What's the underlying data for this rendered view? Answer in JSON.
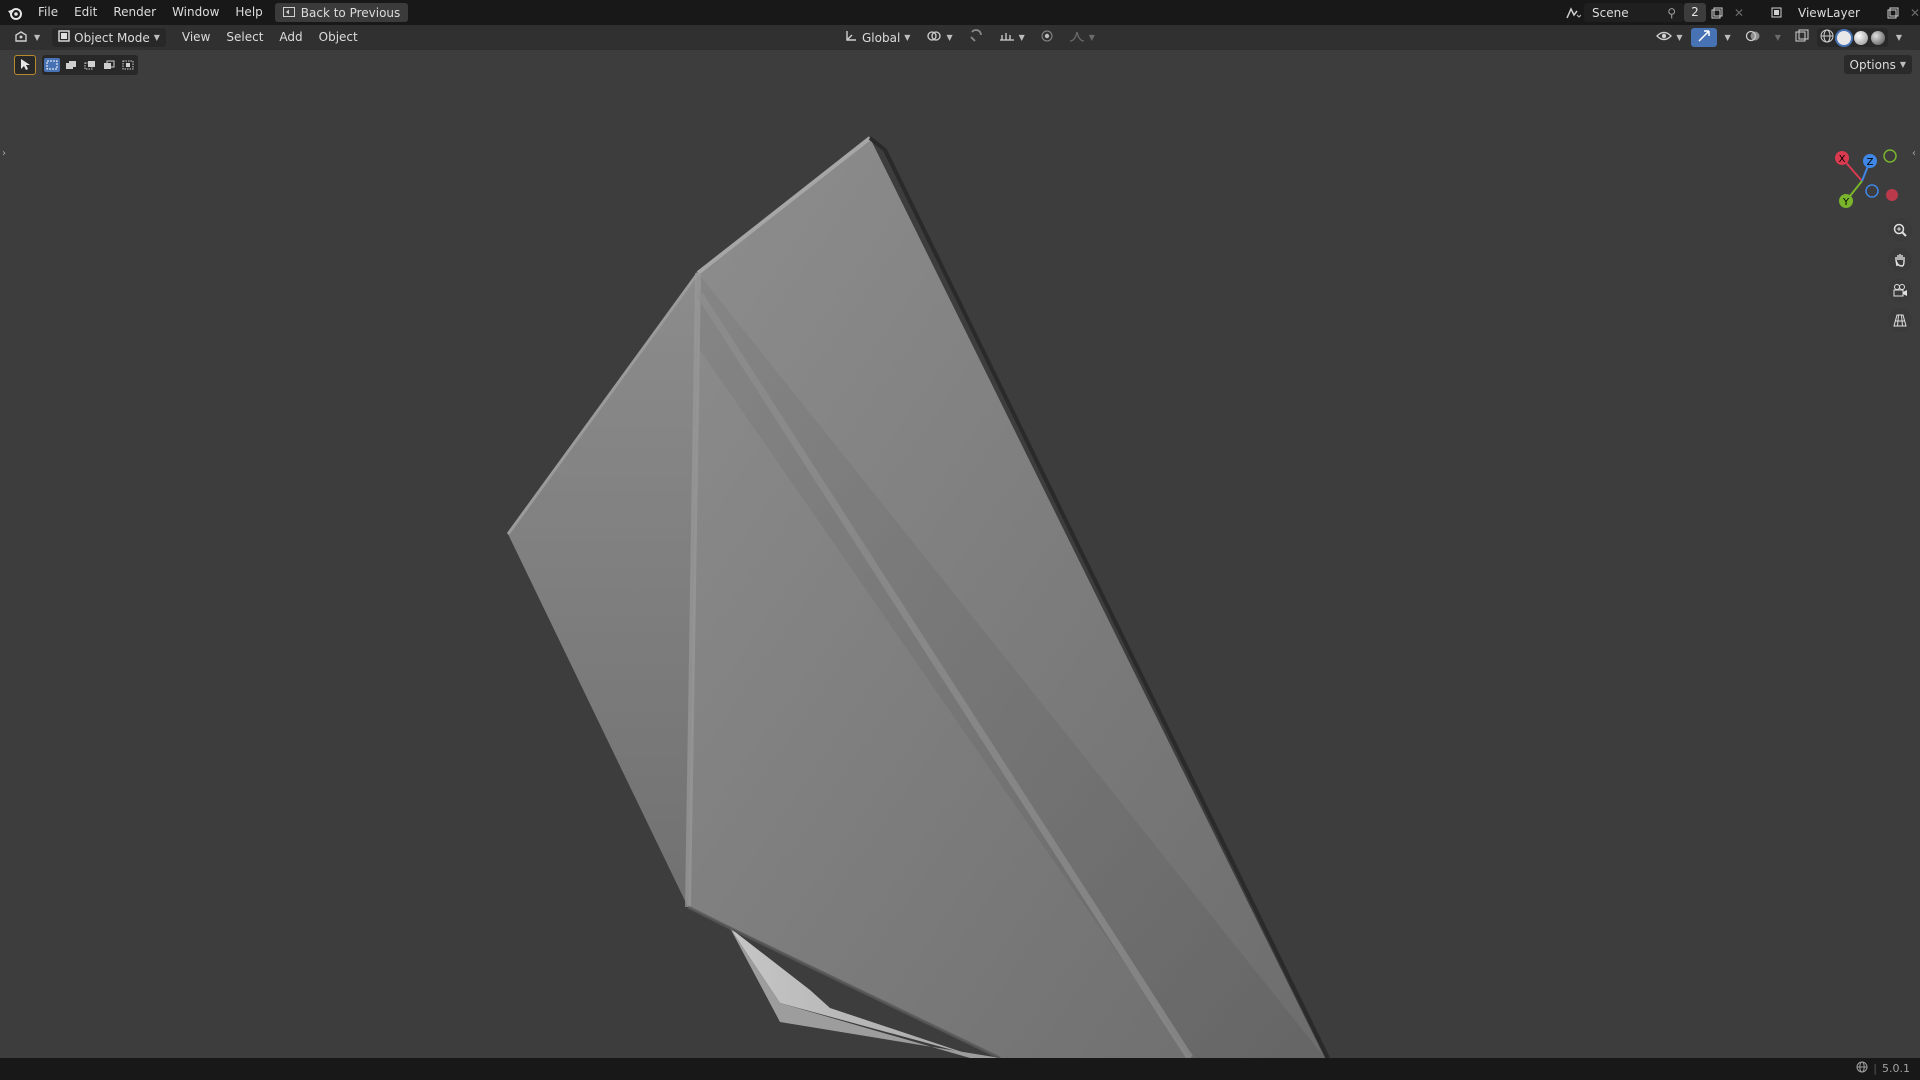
{
  "topbar": {
    "menus": [
      "File",
      "Edit",
      "Render",
      "Window",
      "Help"
    ],
    "back_button": "Back to Previous",
    "scene_name": "Scene",
    "scene_users": "2",
    "view_layer": "ViewLayer"
  },
  "header": {
    "object_mode": "Object Mode",
    "menus": [
      "View",
      "Select",
      "Add",
      "Object"
    ],
    "transform_orientation": "Global"
  },
  "toolrow": {
    "options_label": "Options"
  },
  "gizmo": {
    "x": "X",
    "y": "Y",
    "z": "Z",
    "x_color": "#d93a4f",
    "y_color": "#79b42c",
    "z_color": "#3f87e6"
  },
  "status": {
    "version": "5.0.1"
  }
}
